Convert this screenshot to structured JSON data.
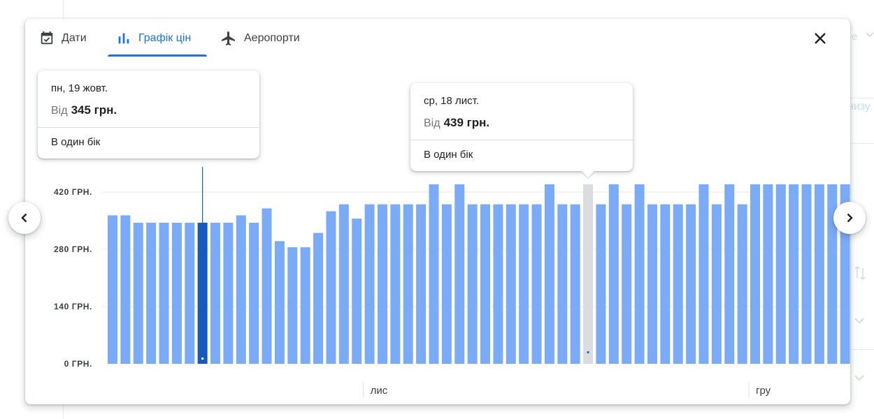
{
  "background": {
    "right_fragment_1": "е",
    "right_fragment_2": "низу"
  },
  "tabs": [
    {
      "label": "Дати",
      "icon": "calendar-check-icon"
    },
    {
      "label": "Графік цін",
      "icon": "bar-chart-icon"
    },
    {
      "label": "Аеропорти",
      "icon": "airplane-icon"
    }
  ],
  "active_tab": 1,
  "close_icon": "close-icon",
  "colors": {
    "accent": "#1a73e8",
    "bar": "#7baaf7",
    "bar_selected": "#185abc",
    "bar_hover": "#dadce0",
    "grid": "#e8eaed",
    "axis_text": "#3c4043"
  },
  "tooltips": [
    {
      "date": "пн, 19 жовт.",
      "price_prefix": "Від",
      "price": "345 грн.",
      "trip": "В один бік"
    },
    {
      "date": "ср, 18 лист.",
      "price_prefix": "Від",
      "price": "439 грн.",
      "trip": "В один бік"
    }
  ],
  "nav": {
    "prev_icon": "chevron-left-icon",
    "next_icon": "chevron-right-icon"
  },
  "chart_data": {
    "type": "bar",
    "y_ticks": [
      {
        "value": 0,
        "label": "0 ГРН."
      },
      {
        "value": 140,
        "label": "140 ГРН."
      },
      {
        "value": 280,
        "label": "280 ГРН."
      },
      {
        "value": 420,
        "label": "420 ГРН."
      }
    ],
    "ylim": [
      0,
      440
    ],
    "grid": true,
    "x_month_labels": [
      {
        "label": "лис",
        "bar_index": 20
      },
      {
        "label": "гру",
        "bar_index": 50
      }
    ],
    "values": [
      363,
      363,
      345,
      345,
      345,
      345,
      345,
      345,
      345,
      345,
      363,
      345,
      380,
      300,
      285,
      285,
      320,
      373,
      390,
      355,
      390,
      390,
      390,
      390,
      390,
      439,
      390,
      439,
      390,
      390,
      390,
      390,
      390,
      390,
      439,
      390,
      390,
      439,
      390,
      439,
      390,
      439,
      390,
      390,
      390,
      390,
      439,
      390,
      439,
      390,
      439,
      439,
      439,
      439,
      439,
      439,
      439,
      439
    ],
    "selected_index": 7,
    "hover_index": 37
  }
}
